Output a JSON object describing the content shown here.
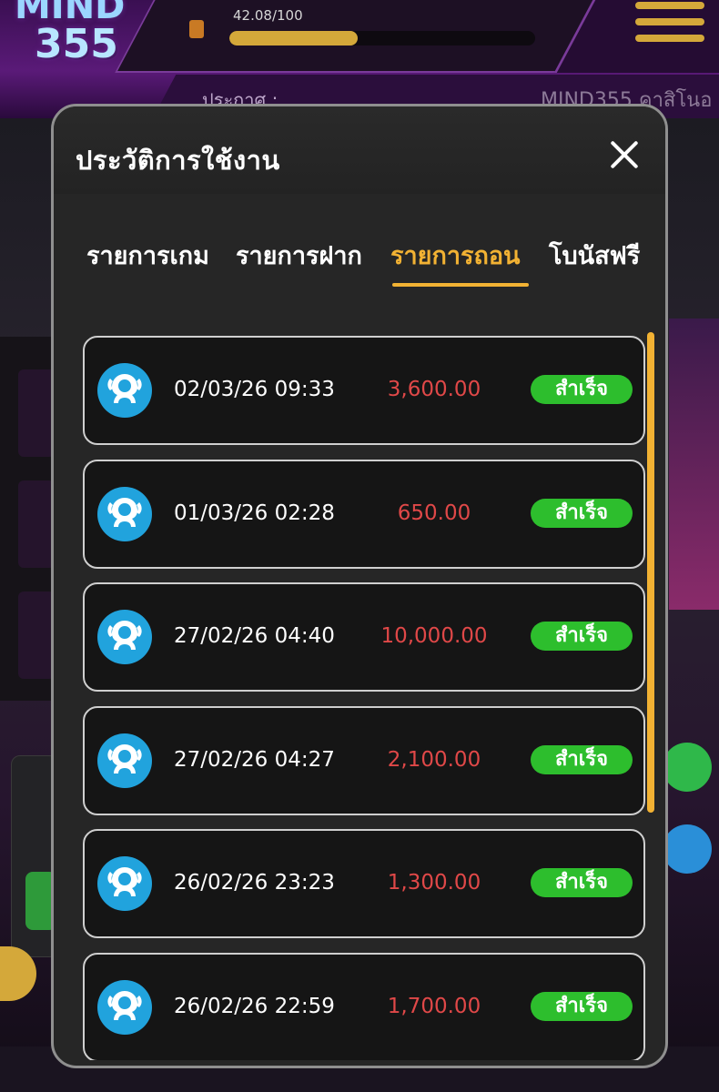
{
  "background": {
    "logo_line1": "MIND",
    "logo_line2": "355",
    "progress_text": "42.08/100",
    "progress_value": 0.4208,
    "news_label": "ประกาศ :",
    "news_text": "MIND355 คาสิโนอ"
  },
  "modal": {
    "title": "ประวัติการใช้งาน",
    "close_icon": "close-icon",
    "tabs": [
      {
        "label": "รายการเกม",
        "active": false
      },
      {
        "label": "รายการฝาก",
        "active": false
      },
      {
        "label": "รายการถอน",
        "active": true
      },
      {
        "label": "โบนัสฟรี",
        "active": false
      }
    ],
    "transactions": [
      {
        "date": "02/03/26 09:33",
        "amount": "3,600.00",
        "status": "สำเร็จ"
      },
      {
        "date": "01/03/26 02:28",
        "amount": "650.00",
        "status": "สำเร็จ"
      },
      {
        "date": "27/02/26 04:40",
        "amount": "10,000.00",
        "status": "สำเร็จ"
      },
      {
        "date": "27/02/26 04:27",
        "amount": "2,100.00",
        "status": "สำเร็จ"
      },
      {
        "date": "26/02/26 23:23",
        "amount": "1,300.00",
        "status": "สำเร็จ"
      },
      {
        "date": "26/02/26 22:59",
        "amount": "1,700.00",
        "status": "สำเร็จ"
      }
    ],
    "bank_icon": "krungthai-bank-icon",
    "colors": {
      "accent": "#f2b233",
      "amount": "#e04848",
      "status_bg": "#2dbe2d",
      "bank_icon_bg": "#21a3dd"
    }
  }
}
